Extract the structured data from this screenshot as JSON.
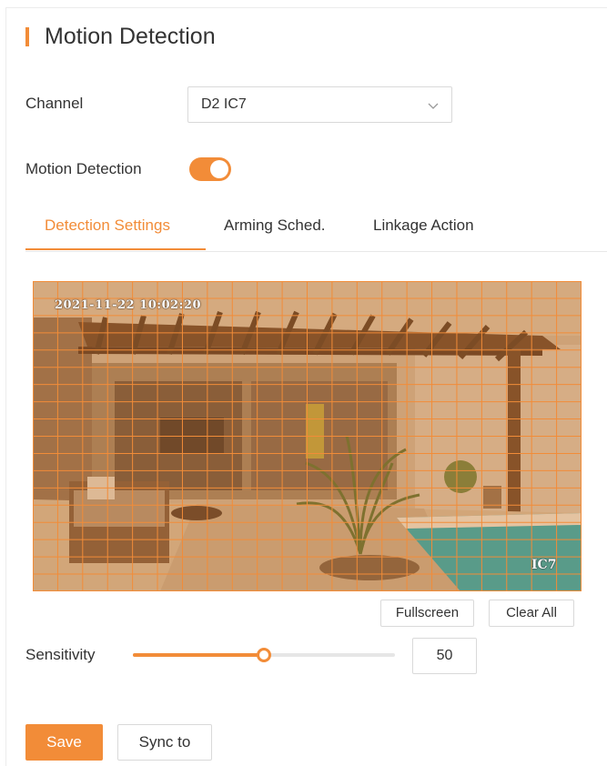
{
  "page": {
    "title": "Motion Detection"
  },
  "channel": {
    "label": "Channel",
    "value": "D2 IC7",
    "icon": "chevron-down-icon"
  },
  "motion_detection": {
    "label": "Motion Detection",
    "enabled": true
  },
  "tabs": [
    {
      "label": "Detection Settings",
      "active": true
    },
    {
      "label": "Arming Sched.",
      "active": false
    },
    {
      "label": "Linkage Action",
      "active": false
    }
  ],
  "video": {
    "timestamp": "2021-11-22 10:02:20",
    "channel_overlay": "IC7",
    "grid_columns": 22,
    "grid_rows": 18,
    "all_cells_selected": true
  },
  "buttons": {
    "fullscreen": "Fullscreen",
    "clear_all": "Clear All",
    "save": "Save",
    "sync_to": "Sync to"
  },
  "sensitivity": {
    "label": "Sensitivity",
    "value": 50,
    "display_value": "50",
    "max": 100
  },
  "colors": {
    "accent": "#f28c38",
    "border": "#d9d9d9",
    "text": "#333333"
  }
}
